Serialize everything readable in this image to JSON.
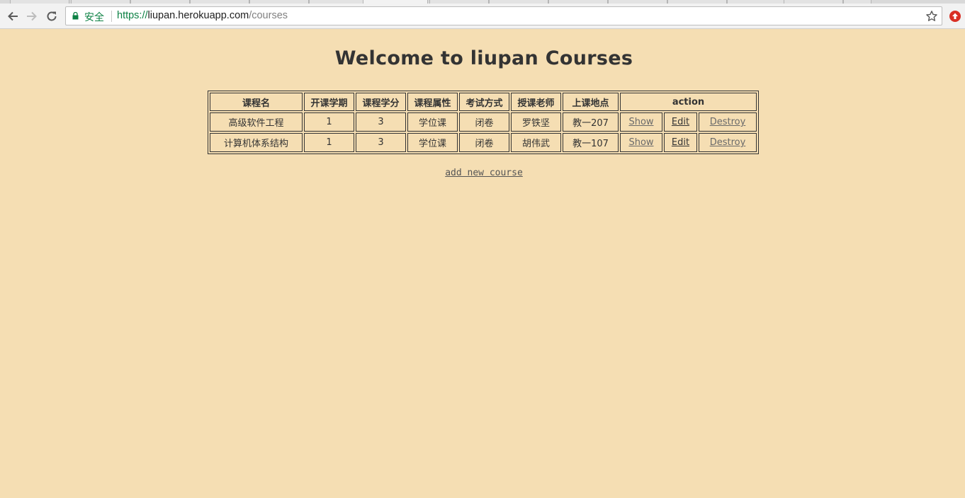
{
  "browser": {
    "secure_label": "安全",
    "url_scheme": "https://",
    "url_host": "liupan.herokuapp.com",
    "url_path": "/courses"
  },
  "page": {
    "title": "Welcome to liupan Courses",
    "add_link": "add new course"
  },
  "table": {
    "headers": [
      "课程名",
      "开课学期",
      "课程学分",
      "课程属性",
      "考试方式",
      "授课老师",
      "上课地点",
      "action"
    ],
    "rows": [
      {
        "name": "高级软件工程",
        "term": "1",
        "credit": "3",
        "type": "学位课",
        "exam": "闭卷",
        "teacher": "罗铁坚",
        "location": "教一207",
        "show": "Show",
        "edit": "Edit",
        "destroy": "Destroy"
      },
      {
        "name": "计算机体系结构",
        "term": "1",
        "credit": "3",
        "type": "学位课",
        "exam": "闭卷",
        "teacher": "胡伟武",
        "location": "教一107",
        "show": "Show",
        "edit": "Edit",
        "destroy": "Destroy"
      }
    ]
  },
  "colors": {
    "page_background": "#f5deb3",
    "text": "#333333",
    "secure_green": "#0b8043"
  }
}
